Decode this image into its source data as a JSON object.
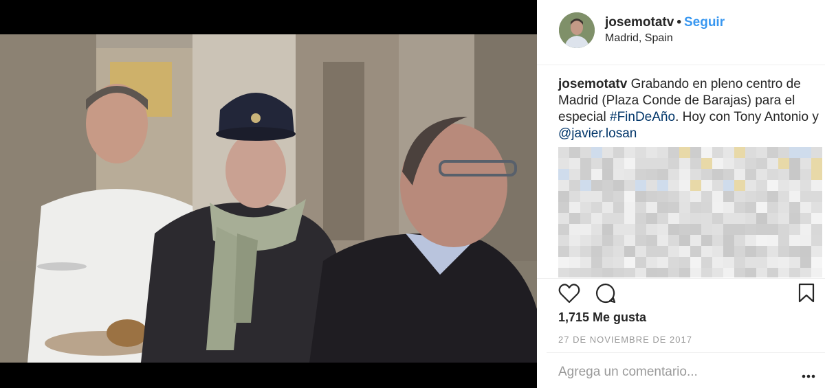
{
  "post": {
    "username": "josemotatv",
    "separator": "•",
    "follow_label": "Seguir",
    "location": "Madrid, Spain"
  },
  "caption": {
    "username": "josemotatv",
    "text_before": "Grabando en pleno centro de Madrid (Plaza Conde de Barajas) para el especial ",
    "hashtag": "#FinDeAño",
    "text_middle": ". Hoy con Tony Antonio y ",
    "mention": "@javier.losan"
  },
  "actions": {
    "like_icon": "heart-icon",
    "comment_icon": "comment-icon",
    "save_icon": "bookmark-icon"
  },
  "likes_text": "1,715 Me gusta",
  "date_text": "27 DE NOVIEMBRE DE 2017",
  "comment": {
    "placeholder": "Agrega un comentario...",
    "more_icon": "more-options-icon"
  },
  "colors": {
    "link_blue": "#3897f0",
    "hashtag_blue": "#003569",
    "muted_gray": "#999999",
    "divider": "#efefef"
  }
}
